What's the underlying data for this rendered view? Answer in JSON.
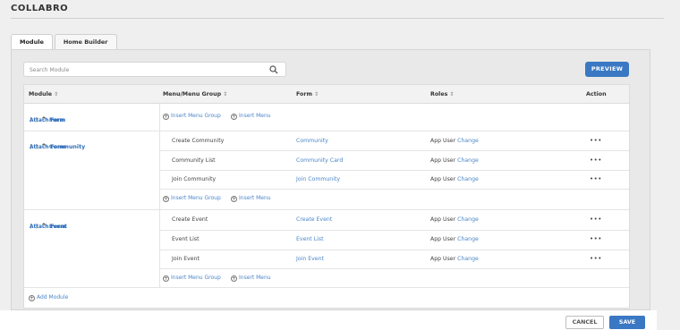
{
  "app": {
    "title": "COLLABRO"
  },
  "tabs": [
    {
      "label": "Module",
      "active": true
    },
    {
      "label": "Home Builder",
      "active": false
    }
  ],
  "search": {
    "placeholder": "Search Module",
    "icon": "search-icon"
  },
  "toolbar": {
    "preview_label": "PREVIEW"
  },
  "table": {
    "headers": {
      "module": "Module",
      "menu": "Menu/Menu Group",
      "form": "Form",
      "roles": "Roles",
      "action": "Action",
      "sort_glyph": "⇕"
    },
    "modules": [
      {
        "name": "Form",
        "attach_label": "Attach Form",
        "rows": [],
        "insert_menu_group": "Insert Menu Group",
        "insert_menu": "Insert Menu"
      },
      {
        "name": "Community",
        "attach_label": "Attach Form",
        "rows": [
          {
            "menu": "Create Community",
            "form": "Community",
            "role": "App User",
            "change": "Change",
            "action": "•••"
          },
          {
            "menu": "Community List",
            "form": "Community Card",
            "role": "App User",
            "change": "Change",
            "action": "•••"
          },
          {
            "menu": "Join Community",
            "form": "Join Community",
            "role": "App User",
            "change": "Change",
            "action": "•••"
          }
        ],
        "insert_menu_group": "Insert Menu Group",
        "insert_menu": "Insert Menu"
      },
      {
        "name": "Event",
        "attach_label": "Attach Form",
        "rows": [
          {
            "menu": "Create Event",
            "form": "Create Event",
            "role": "App User",
            "change": "Change",
            "action": "•••"
          },
          {
            "menu": "Event List",
            "form": "Event List",
            "role": "App User",
            "change": "Change",
            "action": "•••"
          },
          {
            "menu": "Join Event",
            "form": "Join Event",
            "role": "App User",
            "change": "Change",
            "action": "•••"
          }
        ],
        "insert_menu_group": "Insert Menu Group",
        "insert_menu": "Insert Menu"
      }
    ],
    "add_module_label": "Add Module"
  },
  "footer": {
    "cancel_label": "CANCEL",
    "save_label": "SAVE"
  },
  "colors": {
    "accent": "#3a78c3",
    "link": "#4b86c8",
    "module_link": "#2d6dbb"
  }
}
